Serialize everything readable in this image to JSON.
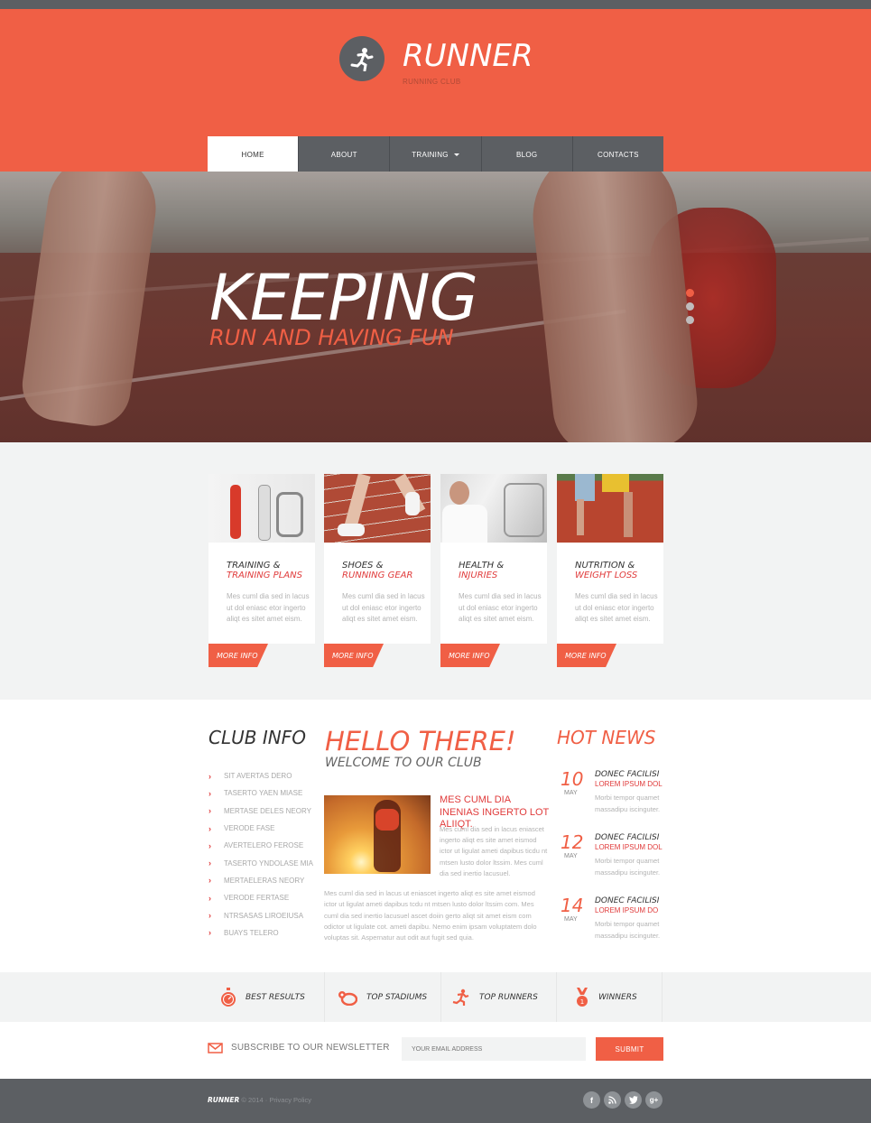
{
  "brand": {
    "name": "RUNNER",
    "tagline": "RUNNING CLUB",
    "accent": "#f05f45",
    "dark": "#5c5f63"
  },
  "nav": {
    "items": [
      {
        "label": "HOME",
        "active": true
      },
      {
        "label": "ABOUT"
      },
      {
        "label": "TRAINING",
        "dropdown": true
      },
      {
        "label": "BLOG"
      },
      {
        "label": "CONTACTS"
      }
    ]
  },
  "hero": {
    "title": "KEEPING",
    "subtitle": "RUN AND HAVING FUN",
    "slides": 3,
    "active_slide": 1
  },
  "features": [
    {
      "title": "TRAINING &",
      "highlight": "TRAINING PLANS",
      "text": "Mes cuml dia sed in lacus ut dol eniasc etor ingerto aliqt es sitet amet eism.",
      "button": "MORE INFO"
    },
    {
      "title": "SHOES &",
      "highlight": "RUNNING GEAR",
      "text": "Mes cuml dia sed in lacus ut dol eniasc etor ingerto aliqt es sitet amet eism.",
      "button": "MORE INFO"
    },
    {
      "title": "HEALTH &",
      "highlight": "INJURIES",
      "text": "Mes cuml dia sed in lacus ut dol eniasc etor ingerto aliqt es sitet amet eism.",
      "button": "MORE INFO"
    },
    {
      "title": "NUTRITION &",
      "highlight": "WEIGHT LOSS",
      "text": "Mes cuml dia sed in lacus ut dol eniasc etor ingerto aliqt es sitet amet eism.",
      "button": "MORE INFO"
    }
  ],
  "club_info": {
    "heading": "CLUB INFO",
    "items": [
      "SIT AVERTAS DERO",
      "TASERTO YAEN MIASE",
      "MERTASE DELES NEORY",
      "VERODE FASE",
      "AVERTELERO FEROSE",
      "TASERTO YNDOLASE MIA",
      "MERTAELERAS NEORY",
      "VERODE FERTASE",
      "NTRSASAS LIROEIUSA",
      "BUAYS TELERO"
    ]
  },
  "welcome": {
    "heading": "HELLO THERE!",
    "subheading": "WELCOME TO OUR CLUB",
    "lead": "MES CUML DIA INENIAS INGERTO LOT ALIIQT.",
    "para1": "Mes cuml dia sed in lacus eniascet ingerto aliqt es site amet eismod ictor ut ligulat ameti dapibus ticdu nt mtsen lusto dolor ltssim. Mes cuml dia sed inertio lacusuel.",
    "para2": "Mes cuml dia sed in lacus ut eniascet ingerto aliqt es site amet eismod ictor ut ligulat ameti dapibus tcdu nt mtsen lusto dolor ltssim com. Mes cuml dia sed inertio lacusuel ascet doiin gerto aliqt sit amet eism com odictor ut ligulate cot. ameti dapibu. Nemo enim ipsam voluptatem dolo voluptas sit. Aspernatur aut odit aut fugit sed quia."
  },
  "hot_news": {
    "heading": "HOT NEWS",
    "items": [
      {
        "day": "10",
        "month": "MAY",
        "title": "DONEC FACILISI",
        "subtitle": "LOREM IPSUM DOL",
        "text": "Morbi tempor quamet massadipu iscinguter."
      },
      {
        "day": "12",
        "month": "MAY",
        "title": "DONEC FACILISI",
        "subtitle": "LOREM IPSUM DOL",
        "text": "Morbi tempor quamet massadipu iscinguter."
      },
      {
        "day": "14",
        "month": "MAY",
        "title": "DONEC FACILISI",
        "subtitle": "LOREM IPSUM DO",
        "text": "Morbi tempor quamet massadipu iscinguter."
      }
    ]
  },
  "stats": [
    {
      "icon": "stopwatch-icon",
      "label": "BEST RESULTS"
    },
    {
      "icon": "stadium-icon",
      "label": "TOP STADIUMS"
    },
    {
      "icon": "runner-icon",
      "label": "TOP RUNNERS"
    },
    {
      "icon": "medal-icon",
      "label": "WINNERS"
    }
  ],
  "newsletter": {
    "label": "SUBSCRIBE TO OUR NEWSLETTER",
    "placeholder": "YOUR EMAIL ADDRESS",
    "button": "SUBMIT"
  },
  "footer": {
    "brand": "RUNNER",
    "copyright": "© 2014 · Privacy Policy",
    "social": [
      "f",
      "rss",
      "t",
      "g+"
    ]
  }
}
